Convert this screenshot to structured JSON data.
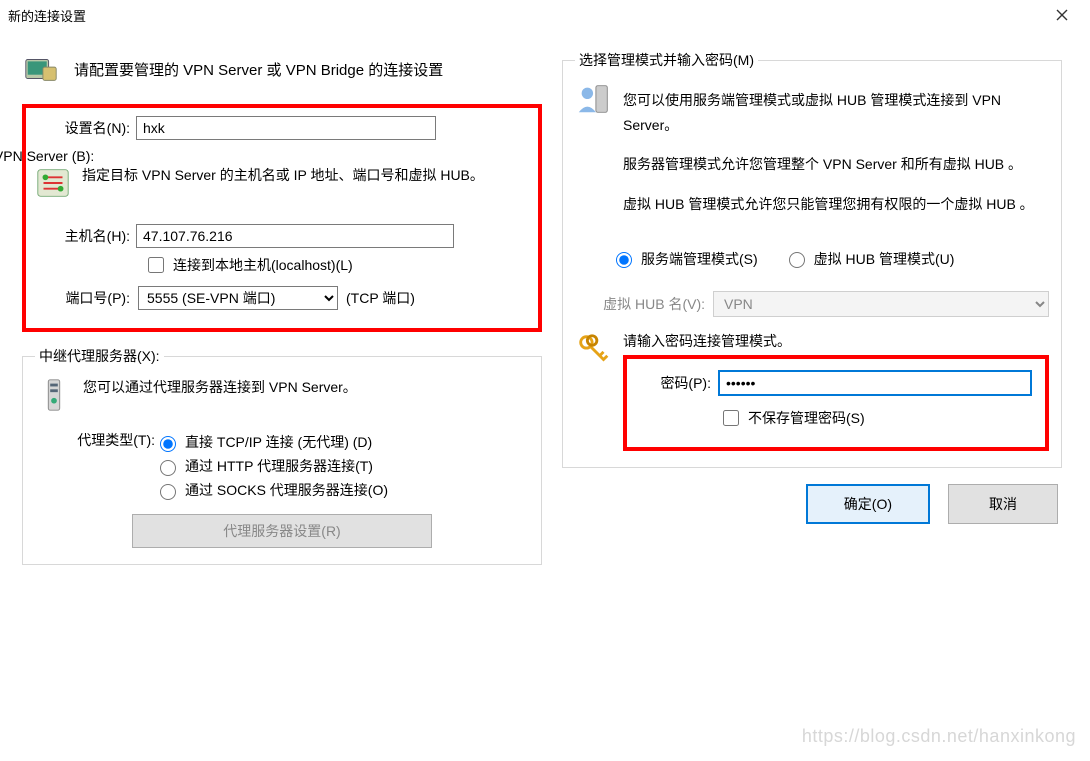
{
  "window": {
    "title": "新的连接设置"
  },
  "intro": "请配置要管理的 VPN Server 或 VPN Bridge 的连接设置",
  "setting_name": {
    "label": "设置名(N):",
    "value": "hxk"
  },
  "target": {
    "legend": "目标 VPN Server (B):",
    "desc": "指定目标 VPN Server 的主机名或 IP 地址、端口号和虚拟 HUB。",
    "host_label": "主机名(H):",
    "host_value": "47.107.76.216",
    "localhost_cb": "连接到本地主机(localhost)(L)",
    "port_label": "端口号(P):",
    "port_value": "5555 (SE-VPN 端口)",
    "port_suffix": "(TCP 端口)"
  },
  "proxy": {
    "legend": "中继代理服务器(X):",
    "desc": "您可以通过代理服务器连接到 VPN Server。",
    "type_label": "代理类型(T):",
    "opt_direct": "直接 TCP/IP 连接 (无代理) (D)",
    "opt_http": "通过 HTTP 代理服务器连接(T)",
    "opt_socks": "通过 SOCKS 代理服务器连接(O)",
    "settings_btn": "代理服务器设置(R)"
  },
  "mode": {
    "legend": "选择管理模式并输入密码(M)",
    "p1": "您可以使用服务端管理模式或虚拟 HUB 管理模式连接到 VPN Server。",
    "p2": "服务器管理模式允许您管理整个 VPN Server 和所有虚拟 HUB 。",
    "p3": "虚拟 HUB 管理模式允许您只能管理您拥有权限的一个虚拟 HUB 。",
    "opt_server": "服务端管理模式(S)",
    "opt_hub": "虚拟 HUB 管理模式(U)",
    "hub_label": "虚拟 HUB 名(V):",
    "hub_value": "VPN",
    "pass_prompt": "请输入密码连接管理模式。",
    "pass_label": "密码(P):",
    "pass_value": "••••••",
    "nosave_cb": "不保存管理密码(S)"
  },
  "buttons": {
    "ok": "确定(O)",
    "cancel": "取消"
  },
  "watermark": "https://blog.csdn.net/hanxinkong"
}
